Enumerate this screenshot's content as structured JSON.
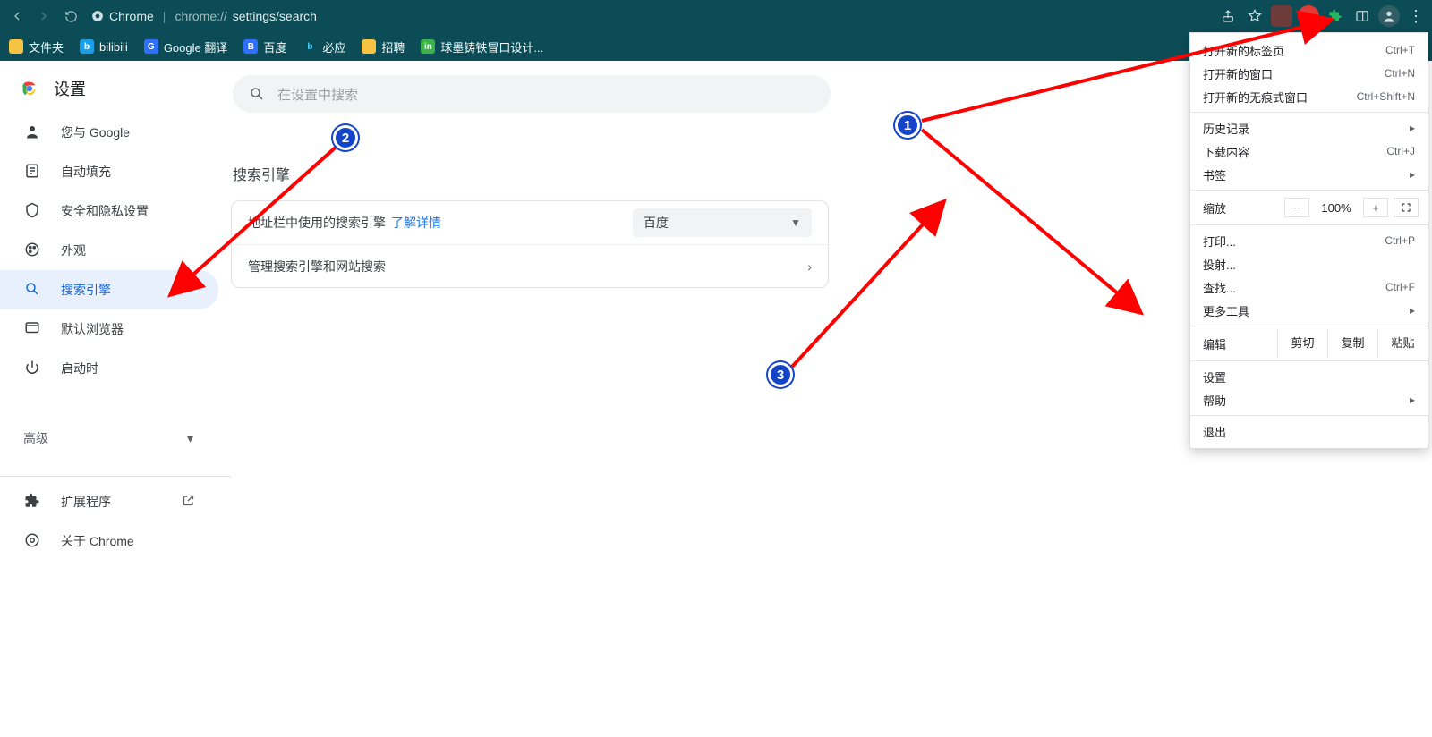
{
  "browser": {
    "url_label_app": "Chrome",
    "url_path_1": "chrome://",
    "url_path_2": "settings/search"
  },
  "bookmarks": [
    {
      "label": "文件夹"
    },
    {
      "label": "bilibili"
    },
    {
      "label": "Google 翻译"
    },
    {
      "label": "百度"
    },
    {
      "label": "必应"
    },
    {
      "label": "招聘"
    },
    {
      "label": "球墨铸铁冒口设计..."
    }
  ],
  "settings": {
    "title": "设置",
    "search_placeholder": "在设置中搜索",
    "nav": [
      {
        "label": "您与 Google"
      },
      {
        "label": "自动填充"
      },
      {
        "label": "安全和隐私设置"
      },
      {
        "label": "外观"
      },
      {
        "label": "搜索引擎"
      },
      {
        "label": "默认浏览器"
      },
      {
        "label": "启动时"
      }
    ],
    "advanced": "高级",
    "extensions": "扩展程序",
    "about": "关于 Chrome",
    "section_title": "搜索引擎",
    "row1_text": "地址栏中使用的搜索引擎",
    "row1_link": "了解详情",
    "row1_select": "百度",
    "row2_text": "管理搜索引擎和网站搜索"
  },
  "menu": {
    "new_tab": "打开新的标签页",
    "new_tab_sc": "Ctrl+T",
    "new_window": "打开新的窗口",
    "new_window_sc": "Ctrl+N",
    "incognito": "打开新的无痕式窗口",
    "incognito_sc": "Ctrl+Shift+N",
    "history": "历史记录",
    "downloads": "下载内容",
    "downloads_sc": "Ctrl+J",
    "bookmarks": "书签",
    "zoom": "缩放",
    "zoom_value": "100%",
    "print": "打印...",
    "print_sc": "Ctrl+P",
    "cast": "投射...",
    "find": "查找...",
    "find_sc": "Ctrl+F",
    "more_tools": "更多工具",
    "edit": "编辑",
    "cut": "剪切",
    "copy": "复制",
    "paste": "粘贴",
    "settings": "设置",
    "help": "帮助",
    "exit": "退出"
  },
  "annotations": {
    "b1": "1",
    "b2": "2",
    "b3": "3"
  }
}
